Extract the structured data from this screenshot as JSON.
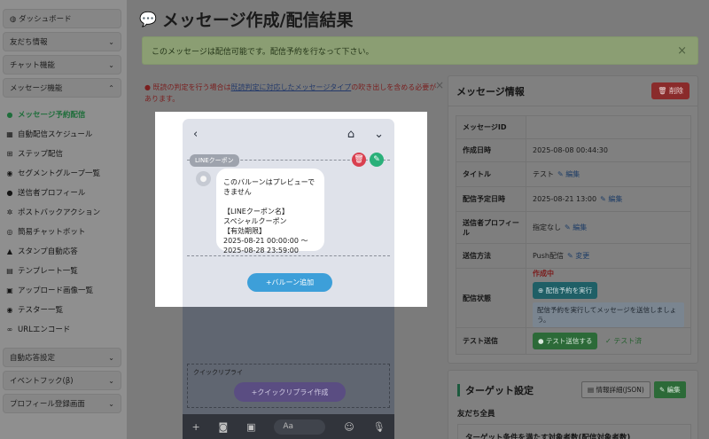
{
  "sidebar": {
    "dashboard": "ダッシュボード",
    "groups": [
      "友だち情報",
      "チャット機能",
      "メッセージ機能"
    ],
    "items": [
      {
        "icon": "comment-icon",
        "label": "メッセージ予約配信"
      },
      {
        "icon": "calendar-icon",
        "label": "自動配信スケジュール"
      },
      {
        "icon": "sitemap-icon",
        "label": "ステップ配信"
      },
      {
        "icon": "users-icon",
        "label": "セグメントグループ一覧"
      },
      {
        "icon": "user-icon",
        "label": "送信者プロフィール"
      },
      {
        "icon": "gear-icon",
        "label": "ポストバックアクション"
      },
      {
        "icon": "robot-icon",
        "label": "簡易チャットボット"
      },
      {
        "icon": "stamp-icon",
        "label": "スタンプ自動応答"
      },
      {
        "icon": "file-icon",
        "label": "テンプレート一覧"
      },
      {
        "icon": "image-icon",
        "label": "アップロード画像一覧"
      },
      {
        "icon": "users-icon",
        "label": "テスター一覧"
      },
      {
        "icon": "link-icon",
        "label": "URLエンコード"
      }
    ],
    "bottom_groups": [
      "自動応答設定",
      "イベントフック(β)",
      "プロフィール登録画面"
    ]
  },
  "page": {
    "title": "メッセージ作成/配信結果",
    "alert": "このメッセージは配信可能です。配信予約を行なって下さい。",
    "warning_prefix": "既読の判定を行う場合は",
    "warning_link": "既読判定に対応したメッセージタイプ",
    "warning_suffix": "の吹き出しを含める必要があります。"
  },
  "info": {
    "title": "メッセージ情報",
    "delete_label": "削除",
    "edit_label": "編集",
    "change_label": "変更",
    "rows": {
      "id_key": "メッセージID",
      "id_val": "",
      "created_key": "作成日時",
      "created_val": "2025-08-08 00:44:30",
      "title_key": "タイトル",
      "title_val": "テスト",
      "scheduled_key": "配信予定日時",
      "scheduled_val": "2025-08-21 13:00",
      "profile_key": "送信者プロフィール",
      "profile_val": "指定なし",
      "method_key": "送信方法",
      "method_val": "Push配信",
      "status_key": "配信状態",
      "status_val": "作成中",
      "status_btn": "配信予約を実行",
      "status_hint": "配信予約を実行してメッセージを送信しましょう。",
      "test_key": "テスト送信",
      "test_btn": "テスト送信する",
      "test_done": "テスト済"
    }
  },
  "target": {
    "title": "ターゲット設定",
    "json_btn": "情報詳細(JSON)",
    "edit_btn": "編集",
    "audience": "友だち全員",
    "condition_label": "ターゲット条件を満たす対象者数(配信対象者数)"
  },
  "preview": {
    "tag": "LINEクーポン",
    "bubble_text": "このバルーンはプレビューできません\n\n【LINEクーポン名】\nスペシャルクーポン\n【有効期限】\n2025-08-21 00:00:00 〜\n2025-08-28 23:59:00",
    "add_balloon": "バルーン追加",
    "quick_reply_label": "クイックリプライ",
    "quick_reply_btn": "クイックリプライ作成",
    "input_placeholder": "Aa"
  }
}
